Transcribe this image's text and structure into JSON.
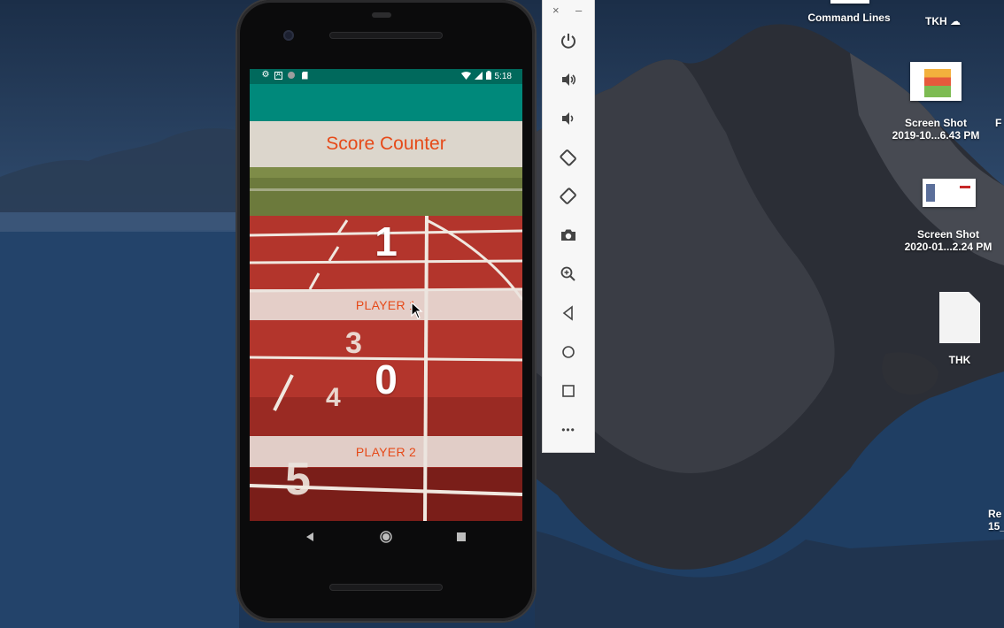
{
  "desktop": {
    "items": [
      {
        "name": "Command Lines"
      },
      {
        "name": "TKH"
      },
      {
        "name": "Screen Shot",
        "subtitle": "2019-10...6.43 PM"
      },
      {
        "name": "Screen Shot",
        "subtitle": "2020-01...2.24 PM"
      },
      {
        "name": "THK"
      },
      {
        "name": "F"
      },
      {
        "name": "Re",
        "subtitle": "15_"
      }
    ]
  },
  "phone": {
    "status_bar": {
      "time": "5:18"
    },
    "app": {
      "title": "Score Counter",
      "player1": {
        "score": "1",
        "label": "PLAYER 1"
      },
      "player2": {
        "score": "0",
        "label": "PLAYER 2"
      }
    }
  },
  "emulator_toolbar": {
    "close": "×",
    "minimize": "–",
    "more": "•••"
  },
  "colors": {
    "status_bar": "#00695c",
    "app_bar": "#00897b",
    "title_text": "#e64a19",
    "player_label": "#e64a19",
    "track_red": "#b8352c"
  }
}
